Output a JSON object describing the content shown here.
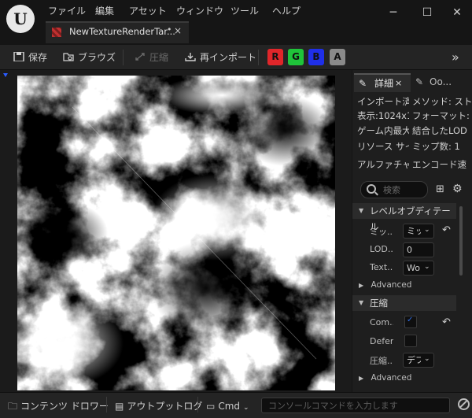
{
  "menu": [
    "ファイル",
    "編集",
    "アセット",
    "ウィンドウ",
    "ツール",
    "ヘルプ"
  ],
  "tab": {
    "label": "NewTextureRenderTar...",
    "modified": "•",
    "close": "×"
  },
  "toolbar": {
    "save": "保存",
    "browse": "ブラウズ",
    "compress": "圧縮",
    "reimport": "再インポート",
    "channels": [
      {
        "label": "R",
        "color": "#e0262a"
      },
      {
        "label": "G",
        "color": "#1fc43a"
      },
      {
        "label": "B",
        "color": "#1f2fe8"
      },
      {
        "label": "A",
        "color": "#8a8a8a"
      }
    ],
    "more": "»"
  },
  "details": {
    "tab1": "詳細",
    "tab2": "Oo...",
    "tab_close": "×",
    "info_left": [
      "インポート済",
      "表示:1024x1(",
      "ゲーム内最大",
      "リソース サイ",
      "アルファチャ"
    ],
    "info_right": [
      "メソッド: スト",
      "フォーマット:",
      "結合したLOD",
      "ミップ数: 1",
      "エンコード速"
    ],
    "search_placeholder": "検索",
    "category1": "レベルオブディテール",
    "props1": [
      {
        "label": "ミッ...",
        "type": "dropdown",
        "value": "ミッ",
        "reset": true
      },
      {
        "label": "LOD...",
        "type": "number",
        "value": "0"
      },
      {
        "label": "Text...",
        "type": "dropdown",
        "value": "Wo"
      }
    ],
    "advanced": "Advanced",
    "category2": "圧縮",
    "props2": [
      {
        "label": "Com...",
        "type": "checkbox",
        "checked": true,
        "reset": true
      },
      {
        "label": "Defer...",
        "type": "checkbox",
        "checked": false
      },
      {
        "label": "圧縮...",
        "type": "dropdown",
        "value": "デフ"
      }
    ]
  },
  "bottom": {
    "content_drawer": "コンテンツ ドロワー",
    "output_log": "アウトプットログ",
    "cmd": "Cmd",
    "console_placeholder": "コンソールコマンドを入力します"
  }
}
